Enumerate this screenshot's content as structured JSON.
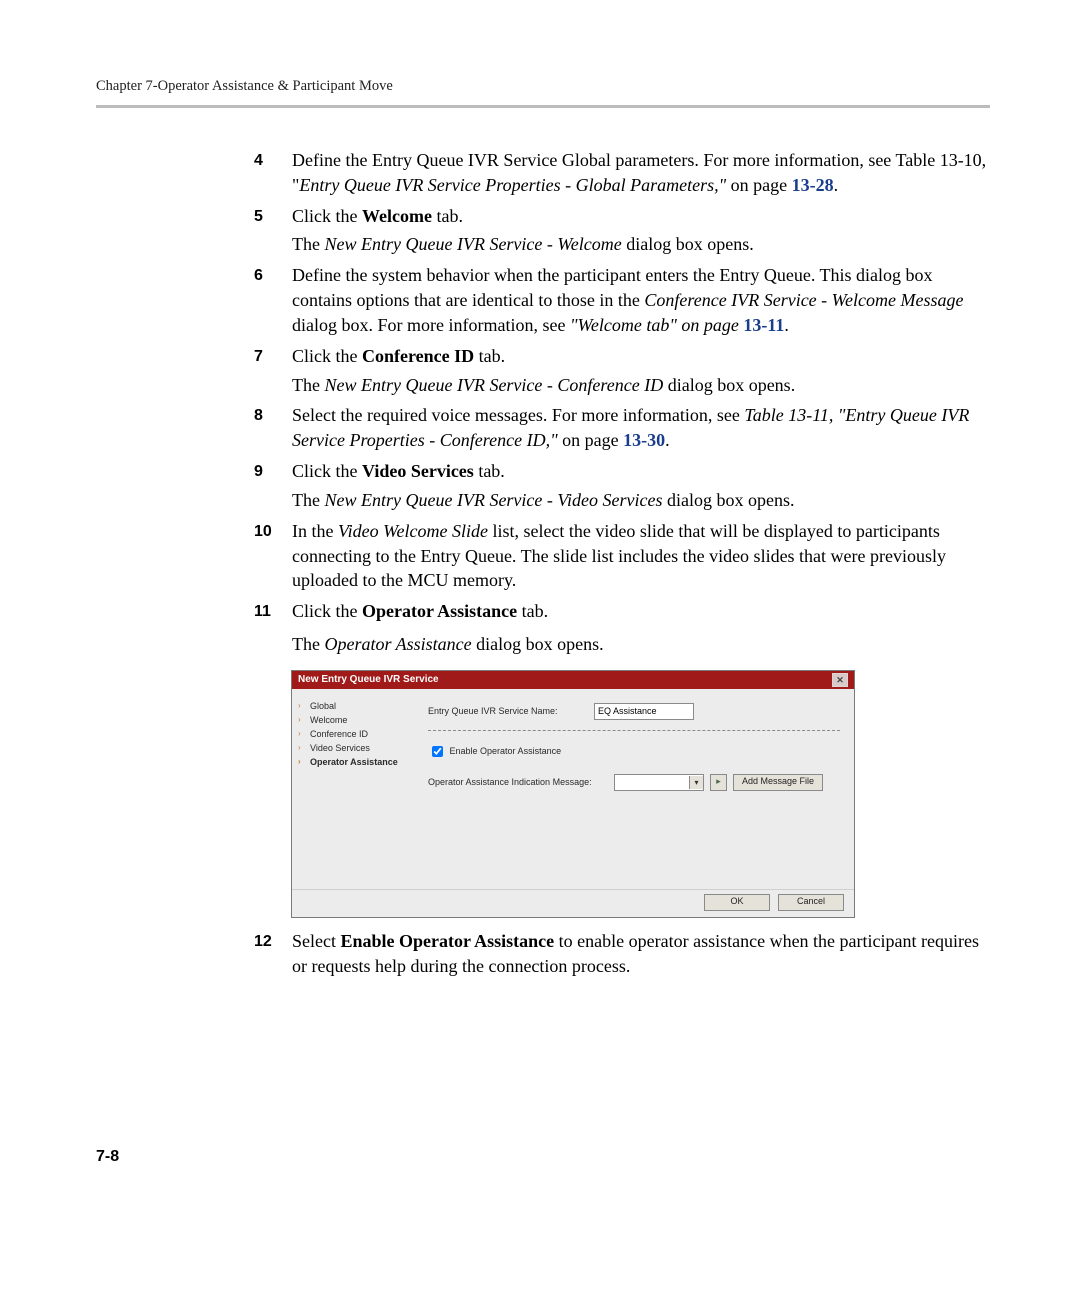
{
  "header": {
    "chapter": "Chapter 7-Operator Assistance & Participant Move"
  },
  "steps": {
    "s4": {
      "num": "4",
      "p1a": "Define the Entry Queue IVR Service Global parameters. For  more information, see Table 13-10, \"",
      "p1i": "Entry Queue IVR Service Properties - Global Parameters,\"",
      "p1b": " on page ",
      "ref": "13-28",
      "p1c": "."
    },
    "s5": {
      "num": "5",
      "p1a": "Click the ",
      "p1b": "Welcome",
      "p1c": " tab.",
      "p2a": "The ",
      "p2i": "New Entry Queue IVR Service - Welcome",
      "p2b": " dialog box opens."
    },
    "s6": {
      "num": "6",
      "p1a": "Define the system behavior when the participant enters the Entry Queue. This dialog box contains options that are identical to those in the ",
      "p1i": "Conference IVR Service - Welcome Message",
      "p1b": " dialog box. For more information, see ",
      "p1i2": "\"Welcome tab\" on page ",
      "ref": "13-11",
      "p1c": "."
    },
    "s7": {
      "num": "7",
      "p1a": "Click the ",
      "p1b": "Conference ID",
      "p1c": " tab.",
      "p2a": "The ",
      "p2i": "New Entry Queue IVR Service - Conference ID",
      "p2b": " dialog box opens."
    },
    "s8": {
      "num": "8",
      "p1a": "Select the required voice messages. For  more information, see ",
      "p1i": "Table 13-11, \"Entry Queue IVR Service Properties - Conference ID,\"",
      "p1b": " on page ",
      "ref": "13-30",
      "p1c": "."
    },
    "s9": {
      "num": "9",
      "p1a": "Click the ",
      "p1b": "Video Services",
      "p1c": " tab.",
      "p2a": "The ",
      "p2i": "New Entry Queue IVR Service - Video Services",
      "p2b": " dialog box opens."
    },
    "s10": {
      "num": "10",
      "p1a": "In the ",
      "p1i": "Video Welcome Slide",
      "p1b": " list, select the video slide that will be displayed to participants connecting to the Entry Queue. The slide list includes the video slides that were previously uploaded to the MCU memory."
    },
    "s11": {
      "num": "11",
      "p1a": "Click the ",
      "p1b": "Operator Assistance",
      "p1c": " tab.",
      "p2a": "The ",
      "p2i": "Operator Assistance",
      "p2b": " dialog box opens."
    },
    "s12": {
      "num": "12",
      "p1a": "Select ",
      "p1b": "Enable Operator Assistance",
      "p1c": " to enable operator assistance when the participant requires or requests help during the connection process."
    }
  },
  "dialog": {
    "title": "New Entry Queue IVR Service",
    "nav": {
      "items": [
        "Global",
        "Welcome",
        "Conference ID",
        "Video Services",
        "Operator Assistance"
      ],
      "selectedIndex": 4
    },
    "fields": {
      "serviceNameLabel": "Entry Queue IVR Service Name:",
      "serviceNameValue": "EQ Assistance",
      "enableLabel": "Enable Operator Assistance",
      "enableChecked": true,
      "msgLabel": "Operator Assistance Indication Message:",
      "addFileLabel": "Add Message File"
    },
    "buttons": {
      "ok": "OK",
      "cancel": "Cancel"
    }
  },
  "footer": {
    "pageNumber": "7-8"
  }
}
